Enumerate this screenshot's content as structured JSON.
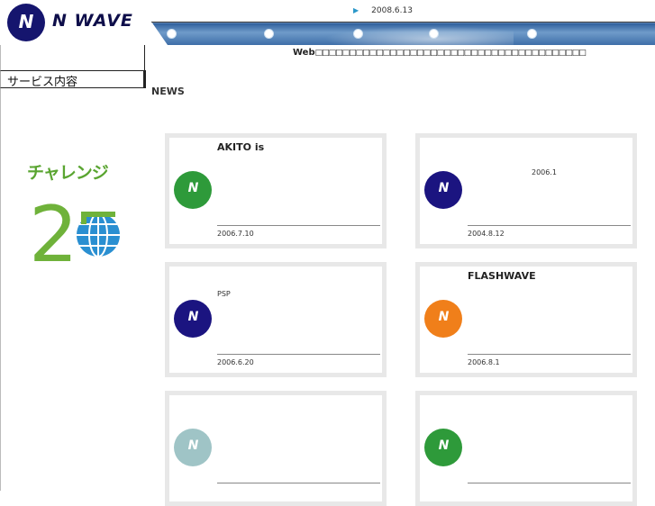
{
  "header": {
    "logo_mark": "N",
    "logo_text": "N WAVE",
    "date": "2008.6.13",
    "arrow_icon": "play-arrow-icon",
    "nav_dots": 5
  },
  "web_title": {
    "lead": "Web",
    "rest": "□□□□□□□□□□□□□□□□□□□□□□□□□□□□□□□□□□□□□□□□"
  },
  "sidebar": {
    "heading": "サービス内容"
  },
  "challenge": {
    "title": "チャレンジ",
    "number": "25"
  },
  "news": {
    "heading": "NEWS",
    "items": [
      {
        "title": "AKITO is",
        "body": "",
        "date": "2006.7.10",
        "logo_color": "#2e9a3a",
        "logo_mark": "N"
      },
      {
        "title": "",
        "body": "2006.1",
        "date": "2004.8.12",
        "logo_color": "#1b1480",
        "logo_mark": "N"
      },
      {
        "title": "",
        "body": "PSP",
        "date": "2006.6.20",
        "logo_color": "#1b1480",
        "logo_mark": "N"
      },
      {
        "title": "FLASHWAVE",
        "body": "",
        "date": "2006.8.1",
        "logo_color": "#f07f1a",
        "logo_mark": "N"
      },
      {
        "title": "",
        "body": "",
        "date": "",
        "logo_color": "#9fc4c6",
        "logo_mark": "N"
      },
      {
        "title": "",
        "body": "",
        "date": "",
        "logo_color": "#2e9a3a",
        "logo_mark": "N"
      }
    ]
  },
  "colors": {
    "brand_navy": "#15156e",
    "challenge_green": "#5aa531",
    "globe_blue": "#2a8fd1",
    "card_border": "#e8e8e8"
  }
}
